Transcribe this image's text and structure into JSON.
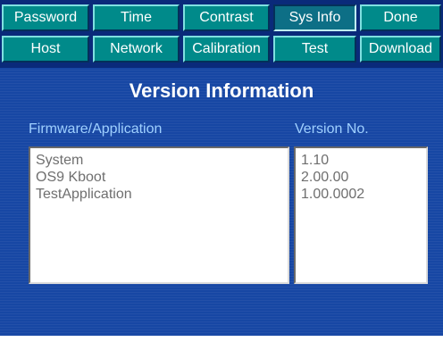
{
  "tabs": {
    "row1": [
      "Password",
      "Time",
      "Contrast",
      "Sys Info",
      "Done"
    ],
    "row2": [
      "Host",
      "Network",
      "Calibration",
      "Test",
      "Download"
    ],
    "active": "Sys Info"
  },
  "panel": {
    "title": "Version Information",
    "col_firmware": "Firmware/Application",
    "col_version": "Version No.",
    "rows": [
      {
        "name": "System",
        "version": "1.10"
      },
      {
        "name": "OS9 Kboot",
        "version": "2.00.00"
      },
      {
        "name": "TestApplication",
        "version": "1.00.0002"
      }
    ]
  },
  "colors": {
    "tab": "#008a8a",
    "tab_active": "#0d6f86",
    "panel": "#1747a4",
    "header_text": "#9fd0ff"
  }
}
